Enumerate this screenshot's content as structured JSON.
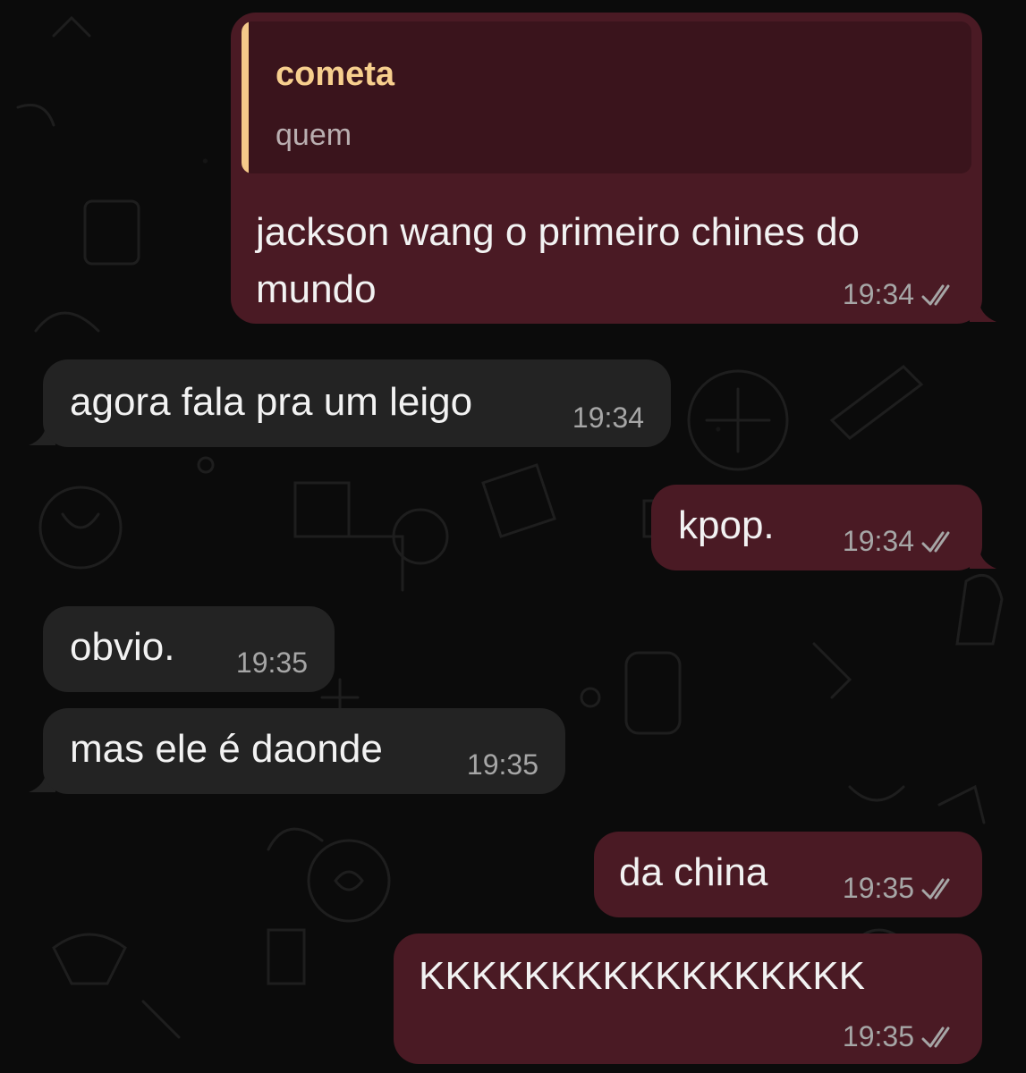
{
  "messages": [
    {
      "direction": "outgoing",
      "quote": {
        "author": "cometa",
        "text": "quem"
      },
      "lines": [
        "jackson wang o primeiro chines do",
        "mundo"
      ],
      "time": "19:34",
      "status": "read"
    },
    {
      "direction": "incoming",
      "text": "agora fala pra um leigo",
      "time": "19:34"
    },
    {
      "direction": "outgoing",
      "text": "kpop.",
      "time": "19:34",
      "status": "read"
    },
    {
      "direction": "incoming",
      "text": "obvio.",
      "time": "19:35"
    },
    {
      "direction": "incoming",
      "text": "mas ele é daonde",
      "time": "19:35"
    },
    {
      "direction": "outgoing",
      "text": "da china",
      "time": "19:35",
      "status": "read"
    },
    {
      "direction": "outgoing",
      "text": "KKKKKKKKKKKKKKKKK",
      "time": "19:35",
      "status": "read"
    }
  ],
  "colors": {
    "outgoing_bubble": "#4a1a24",
    "incoming_bubble": "#232323",
    "quote_accent": "#f5c98a",
    "background": "#0b0b0b"
  },
  "icons": {
    "read_receipt": "double-check-icon"
  }
}
